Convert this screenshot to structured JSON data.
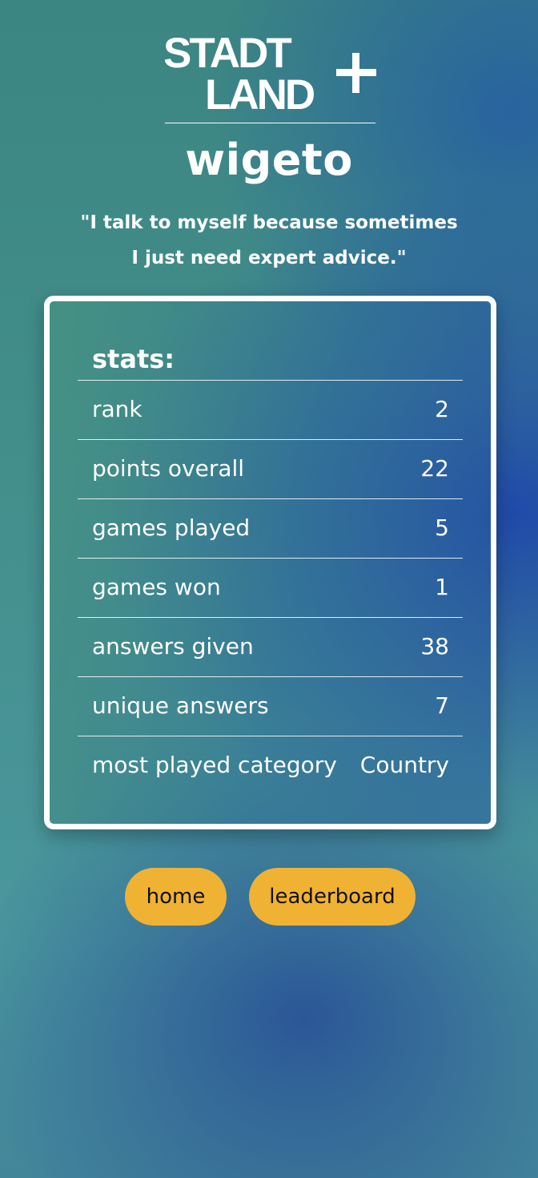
{
  "logo": {
    "line1": "STADT",
    "line2": "LAND",
    "plus": "+"
  },
  "profile": {
    "username": "wigeto",
    "quote": "\"I talk to myself because sometimes I just need expert advice.\""
  },
  "stats": {
    "title": "stats:",
    "rows": [
      {
        "label": "rank",
        "value": "2"
      },
      {
        "label": "points overall",
        "value": "22"
      },
      {
        "label": "games played",
        "value": "5"
      },
      {
        "label": "games won",
        "value": "1"
      },
      {
        "label": "answers given",
        "value": "38"
      },
      {
        "label": "unique answers",
        "value": "7"
      },
      {
        "label": "most played category",
        "value": "Country"
      }
    ]
  },
  "nav": {
    "home_label": "home",
    "leaderboard_label": "leaderboard"
  },
  "colors": {
    "button": "#f0b233",
    "text": "#ffffff",
    "button_text": "#111111"
  }
}
